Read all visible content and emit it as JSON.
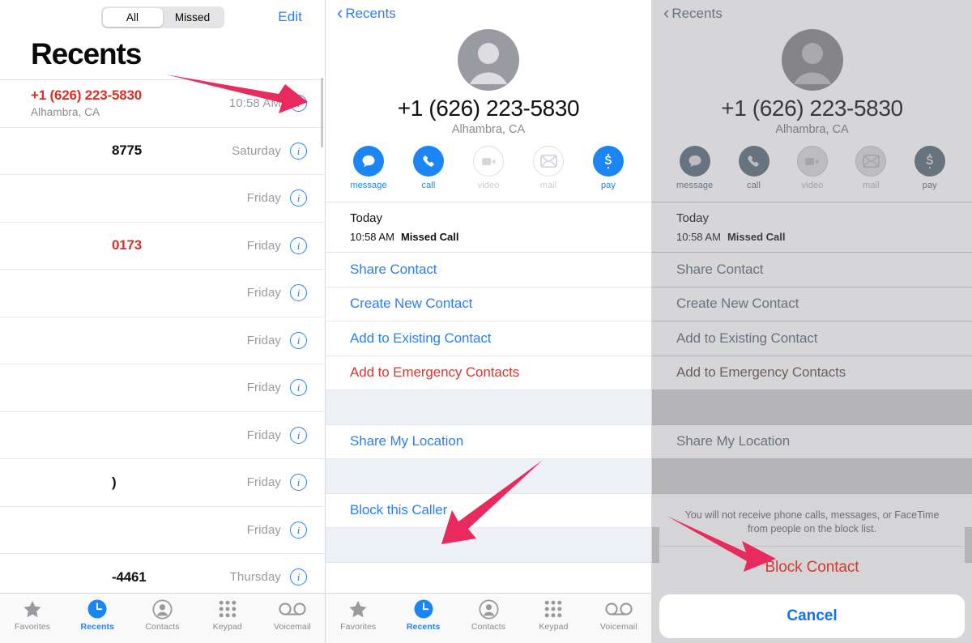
{
  "recents": {
    "segmented": {
      "options": [
        "All",
        "Missed"
      ],
      "selected": "All"
    },
    "edit_label": "Edit",
    "title": "Recents",
    "calls": [
      {
        "name": "+1 (626) 223-5830",
        "sub": "Alhambra, CA",
        "time": "10:58 AM",
        "missed": true,
        "redacted": false
      },
      {
        "name": "8775",
        "sub": "",
        "time": "Saturday",
        "missed": false,
        "redacted": true
      },
      {
        "name": "",
        "sub": "",
        "time": "Friday",
        "missed": false,
        "redacted": true
      },
      {
        "name": "0173",
        "sub": "",
        "time": "Friday",
        "missed": true,
        "redacted": true
      },
      {
        "name": "",
        "sub": "",
        "time": "Friday",
        "missed": false,
        "redacted": true
      },
      {
        "name": "",
        "sub": "",
        "time": "Friday",
        "missed": false,
        "redacted": true
      },
      {
        "name": "",
        "sub": "",
        "time": "Friday",
        "missed": false,
        "redacted": true
      },
      {
        "name": "",
        "sub": "",
        "time": "Friday",
        "missed": false,
        "redacted": true
      },
      {
        "name": ")",
        "sub": "",
        "time": "Friday",
        "missed": false,
        "redacted": true
      },
      {
        "name": "",
        "sub": "",
        "time": "Friday",
        "missed": false,
        "redacted": true
      },
      {
        "name": "-4461",
        "sub": "",
        "time": "Thursday",
        "missed": false,
        "redacted": true
      }
    ]
  },
  "tabbar": {
    "items": [
      {
        "label": "Favorites",
        "icon": "star-icon",
        "active": false
      },
      {
        "label": "Recents",
        "icon": "clock-icon",
        "active": true
      },
      {
        "label": "Contacts",
        "icon": "contacts-icon",
        "active": false
      },
      {
        "label": "Keypad",
        "icon": "keypad-icon",
        "active": false
      },
      {
        "label": "Voicemail",
        "icon": "voicemail-icon",
        "active": false
      }
    ]
  },
  "detail": {
    "back_label": "Recents",
    "number": "+1 (626) 223-5830",
    "location": "Alhambra, CA",
    "actions": [
      {
        "label": "message",
        "icon": "message-icon",
        "enabled": true
      },
      {
        "label": "call",
        "icon": "phone-icon",
        "enabled": true
      },
      {
        "label": "video",
        "icon": "video-icon",
        "enabled": false
      },
      {
        "label": "mail",
        "icon": "mail-icon",
        "enabled": false
      },
      {
        "label": "pay",
        "icon": "dollar-icon",
        "enabled": true
      }
    ],
    "history_heading": "Today",
    "history_time": "10:58 AM",
    "history_type": "Missed Call",
    "menu": [
      {
        "label": "Share Contact",
        "style": "link",
        "blank": false
      },
      {
        "label": "Create New Contact",
        "style": "link",
        "blank": false
      },
      {
        "label": "Add to Existing Contact",
        "style": "link",
        "blank": false
      },
      {
        "label": "Add to Emergency Contacts",
        "style": "danger",
        "blank": false
      },
      {
        "label": "",
        "style": "blank",
        "blank": true
      },
      {
        "label": "Share My Location",
        "style": "link",
        "blank": false
      },
      {
        "label": "",
        "style": "blank",
        "blank": true
      },
      {
        "label": "Block this Caller",
        "style": "link",
        "blank": false
      },
      {
        "label": "",
        "style": "blank",
        "blank": true
      }
    ]
  },
  "action_sheet": {
    "message": "You will not receive phone calls, messages, or FaceTime from people on the block list.",
    "confirm_label": "Block Contact",
    "cancel_label": "Cancel"
  },
  "colors": {
    "accent_blue": "#2b7ff0",
    "action_blue": "#1a85f5",
    "destructive_red": "#d5382f",
    "missed_red": "#d93025",
    "arrow_pink": "#e82a5e",
    "muted_gray": "#8a8a8e"
  },
  "annotations": {
    "arrow_1_target": "info-button-first-call",
    "arrow_2_target": "block-this-caller",
    "arrow_3_target": "block-contact-confirm"
  }
}
